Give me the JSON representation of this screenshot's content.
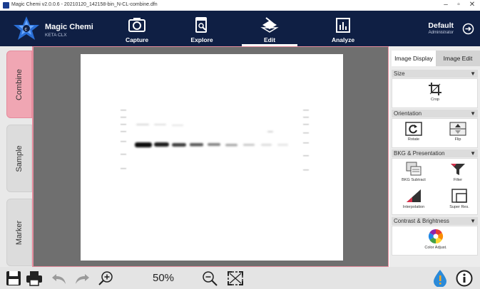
{
  "window": {
    "title": "Magic Chemi v2.0.0.6 - 20210120_142158-bin_N-CL-combine.dfn",
    "controls": [
      "minimize",
      "maximize",
      "close"
    ]
  },
  "brand": {
    "name": "Magic Chemi",
    "subtitle": "KETA CLX"
  },
  "nav": {
    "tabs": [
      {
        "label": "Capture",
        "icon": "camera-icon"
      },
      {
        "label": "Explore",
        "icon": "explore-icon"
      },
      {
        "label": "Edit",
        "icon": "edit-icon",
        "active": true
      },
      {
        "label": "Analyze",
        "icon": "analyze-icon"
      }
    ]
  },
  "user": {
    "name": "Default",
    "role": "Administrator"
  },
  "left_tabs": [
    {
      "label": "Combine",
      "active": true
    },
    {
      "label": "Sample"
    },
    {
      "label": "Marker"
    }
  ],
  "panel": {
    "tabs": [
      {
        "label": "Image Display",
        "active": true
      },
      {
        "label": "Image Edit"
      }
    ],
    "sections": {
      "size": {
        "title": "Size",
        "tools": [
          "Crop"
        ]
      },
      "orientation": {
        "title": "Orientation",
        "tools": [
          "Rotate",
          "Flip"
        ]
      },
      "bkg": {
        "title": "BKG & Presentation",
        "tools": [
          "BKG Subtract",
          "Filter",
          "Interpolation",
          "Super Res."
        ]
      },
      "contrast": {
        "title": "Contrast & Brightness",
        "tools": [
          "Color Adjust."
        ]
      }
    }
  },
  "bottom": {
    "zoom": "50%"
  },
  "colors": {
    "nav_bg": "#0f1f44",
    "active_tab": "#f0a6b3",
    "canvas_bg": "#6f6f6f"
  }
}
